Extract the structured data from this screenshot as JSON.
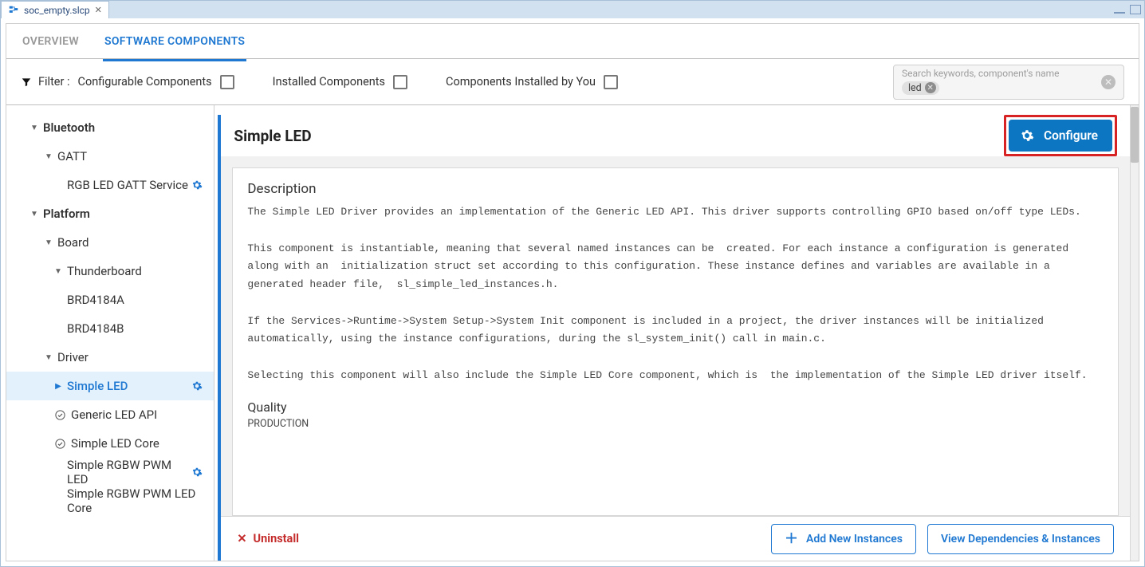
{
  "tab": {
    "file_name": "soc_empty.slcp"
  },
  "top_tabs": {
    "overview": "OVERVIEW",
    "software": "SOFTWARE COMPONENTS"
  },
  "filters": {
    "prefix": "Filter :",
    "configurable": "Configurable Components",
    "installed": "Installed Components",
    "by_you": "Components Installed by You"
  },
  "search": {
    "placeholder": "Search keywords, component's name",
    "chip": "led"
  },
  "tree": {
    "bluetooth": "Bluetooth",
    "gatt": "GATT",
    "rgb_gatt": "RGB LED GATT Service",
    "platform": "Platform",
    "board": "Board",
    "thunderboard": "Thunderboard",
    "brd_a": "BRD4184A",
    "brd_b": "BRD4184B",
    "driver": "Driver",
    "simple_led": "Simple LED",
    "generic_led_api": "Generic LED API",
    "simple_led_core": "Simple LED Core",
    "rgbw_pwm": "Simple RGBW PWM LED",
    "rgbw_pwm_core": "Simple RGBW PWM LED Core"
  },
  "detail": {
    "title": "Simple LED",
    "configure": "Configure",
    "description_head": "Description",
    "description_body": "The Simple LED Driver provides an implementation of the Generic LED API. This driver supports controlling GPIO based on/off type LEDs.\n\nThis component is instantiable, meaning that several named instances can be  created. For each instance a configuration is generated along with an  initialization struct set according to this configuration. These instance defines and variables are available in a generated header file,  sl_simple_led_instances.h.\n\nIf the Services->Runtime->System Setup->System Init component is included in a project, the driver instances will be initialized automatically, using the instance configurations, during the sl_system_init() call in main.c.\n\nSelecting this component will also include the Simple LED Core component, which is  the implementation of the Simple LED driver itself.",
    "quality_head": "Quality",
    "quality_value": "PRODUCTION",
    "uninstall": "Uninstall",
    "add_instances": "Add New Instances",
    "view_deps": "View Dependencies & Instances"
  }
}
